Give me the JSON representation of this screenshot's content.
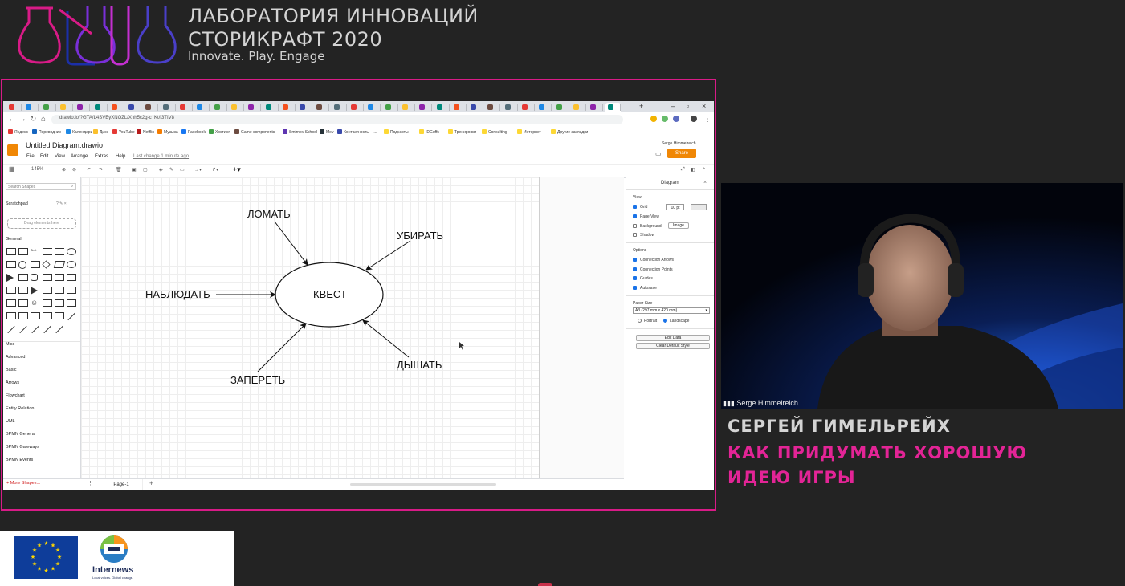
{
  "header": {
    "title_line1": "ЛАБОРАТОРИЯ ИННОВАЦИЙ",
    "title_line2": "СТОРИКРАФТ 2020",
    "tagline": "Innovate. Play. Engage"
  },
  "browser": {
    "url": "drawio.io/?GTA/L4SVEyXNOZL/Xnh5c2g-c_Kt/I3TIV8",
    "bookmarks": [
      {
        "label": "Яндекс",
        "color": "#e53935"
      },
      {
        "label": "Переводчик",
        "color": "#1565c0"
      },
      {
        "label": "Календарь",
        "color": "#1e88e5"
      },
      {
        "label": "Диск",
        "color": "#fbc02d"
      },
      {
        "label": "YouTube",
        "color": "#e53935"
      },
      {
        "label": "Netflix",
        "color": "#b71c1c"
      },
      {
        "label": "Музыка",
        "color": "#f57c00"
      },
      {
        "label": "Facebook",
        "color": "#1877f2"
      },
      {
        "label": "Хостинг",
        "color": "#43a047"
      },
      {
        "label": "Game components",
        "color": "#6d4c41"
      },
      {
        "label": "Smirnov School",
        "color": "#5e35b1"
      },
      {
        "label": "Mev",
        "color": "#263238"
      },
      {
        "label": "Контактность —...",
        "color": "#3949ab"
      },
      {
        "label": "Подкасты",
        "color": "#fdd835"
      },
      {
        "label": "IDGuffs",
        "color": "#fdd835"
      },
      {
        "label": "Тренировки",
        "color": "#fdd835"
      },
      {
        "label": "Consulting",
        "color": "#fdd835"
      },
      {
        "label": "Интернет",
        "color": "#fdd835"
      },
      {
        "label": "Другие закладки",
        "color": "#fdd835"
      }
    ]
  },
  "drawio": {
    "file_title": "Untitled Diagram.drawio",
    "menus": [
      "File",
      "Edit",
      "View",
      "Arrange",
      "Extras",
      "Help"
    ],
    "last_change": "Last change 1 minute ago",
    "user_name": "Serge Himmelreich",
    "share_label": "Share",
    "zoom": "145%",
    "search_placeholder": "Search Shapes",
    "scratchpad": "Scratchpad",
    "drag_hint": "Drag elements here",
    "general": "General",
    "categories": [
      "Misc",
      "Advanced",
      "Basic",
      "Arrows",
      "Flowchart",
      "Entity Relation",
      "UML",
      "BPMN General",
      "BPMN Gateways",
      "BPMN Events"
    ],
    "more_shapes": "+ More Shapes...",
    "page_tab": "Page-1",
    "diagram": {
      "center": "КВЕСТ",
      "nodes": [
        "ЛОМАТЬ",
        "УБИРАТЬ",
        "НАБЛЮДАТЬ",
        "ЗАПЕРЕТЬ",
        "ДЫШАТЬ"
      ]
    },
    "panel": {
      "title": "Diagram",
      "view_section": "View",
      "grid": "Grid",
      "grid_size": "10 pt",
      "page_view": "Page View",
      "background": "Background",
      "image_btn": "Image",
      "shadow": "Shadow",
      "options_section": "Options",
      "connection_arrows": "Connection Arrows",
      "connection_points": "Connection Points",
      "guides": "Guides",
      "autosave": "Autosave",
      "paper_size_label": "Paper Size",
      "paper_size": "A3 (297 mm x 420 mm)",
      "portrait": "Portrait",
      "landscape": "Landscape",
      "edit_data": "Edit Data",
      "clear_style": "Clear Default Style"
    }
  },
  "webcam": {
    "participant": "Serge Himmelreich"
  },
  "speaker": {
    "name": "СЕРГЕЙ ГИМЕЛЬРЕЙХ",
    "topic_line1": "КАК ПРИДУМАТЬ ХОРОШУЮ",
    "topic_line2": "ИДЕЮ ИГРЫ"
  },
  "sponsors": {
    "internews_name": "Internews",
    "internews_tagline": "Local voices. Global change."
  },
  "colors": {
    "accent_pink": "#e32496",
    "frame_pink": "#d81b87",
    "drawio_orange": "#f08705",
    "background": "#232323"
  }
}
